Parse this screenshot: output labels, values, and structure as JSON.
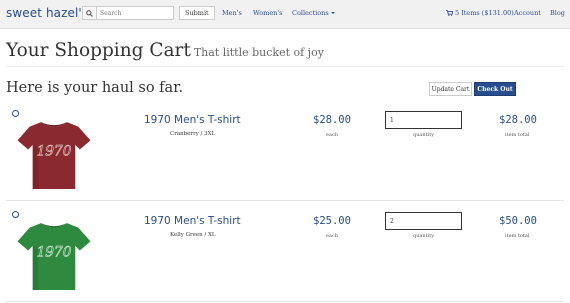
{
  "navbar": {
    "brand": "sweet hazel's",
    "search_placeholder": "Search",
    "submit_label": "Submit",
    "links": {
      "mens": "Men's",
      "womens": "Women's",
      "collections": "Collections",
      "cart": "5 Items ($131.00)",
      "account": "Account",
      "blog": "Blog"
    }
  },
  "header": {
    "title": "Your Shopping Cart",
    "subtitle": "That little bucket of joy"
  },
  "cart": {
    "heading": "Here is your haul so far.",
    "update_label": "Update Cart",
    "checkout_label": "Check Out",
    "items": [
      {
        "title": "1970 Men's T-shirt",
        "variant": "Cranberry / 3XL",
        "price": "$28.00",
        "price_label": "each",
        "quantity": "1",
        "quantity_label": "quantity",
        "total": "$28.00",
        "total_label": "item total",
        "shirt_color": "#8b2a2e",
        "shirt_shade": "#742226",
        "shirt_print": "1970"
      },
      {
        "title": "1970 Men's T-shirt",
        "variant": "Kelly Green / XL",
        "price": "$25.00",
        "price_label": "each",
        "quantity": "2",
        "quantity_label": "quantity",
        "total": "$50.00",
        "total_label": "item total",
        "shirt_color": "#2e8a3e",
        "shirt_shade": "#257333",
        "shirt_print": "1970"
      }
    ]
  },
  "colors": {
    "accent": "#274d8f",
    "navbar_bg": "#f1f1f1"
  },
  "icons": {
    "search": "search-icon",
    "cart": "cart-icon",
    "caret": "chevron-down-icon",
    "radio": "radio-icon"
  }
}
